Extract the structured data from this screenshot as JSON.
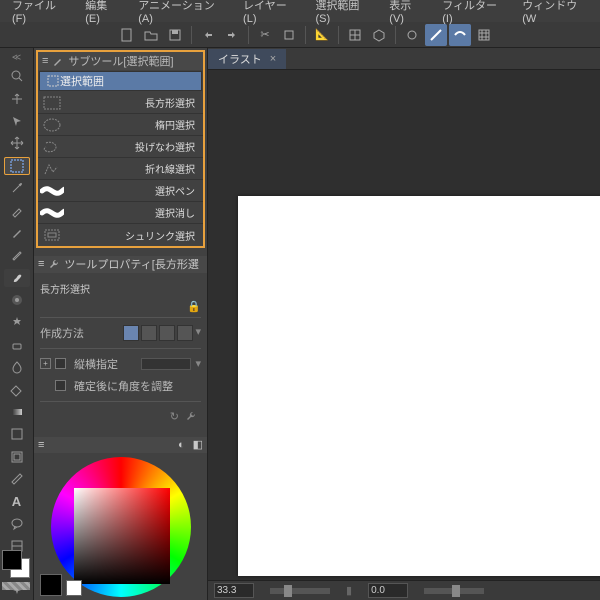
{
  "menu": [
    "ファイル(F)",
    "編集(E)",
    "アニメーション(A)",
    "レイヤー(L)",
    "選択範囲(S)",
    "表示(V)",
    "フィルター(I)",
    "ウィンドウ(W"
  ],
  "subtool": {
    "header": "サブツール[選択範囲]",
    "tab": "選択範囲",
    "items": [
      {
        "label": "長方形選択",
        "icon": "rect"
      },
      {
        "label": "楕円選択",
        "icon": "ellipse"
      },
      {
        "label": "投げなわ選択",
        "icon": "lasso"
      },
      {
        "label": "折れ線選択",
        "icon": "polyline"
      },
      {
        "label": "選択ペン",
        "icon": "wave"
      },
      {
        "label": "選択消し",
        "icon": "wave"
      },
      {
        "label": "シュリンク選択",
        "icon": "shrink"
      }
    ]
  },
  "prop": {
    "header": "ツールプロパティ[長方形選",
    "title": "長方形選択",
    "method_label": "作成方法",
    "aspect_label": "縦横指定",
    "angle_label": "確定後に角度を調整"
  },
  "doctab": {
    "label": "イラスト"
  },
  "status": {
    "zoom": "33.3",
    "rot": "0.0"
  }
}
